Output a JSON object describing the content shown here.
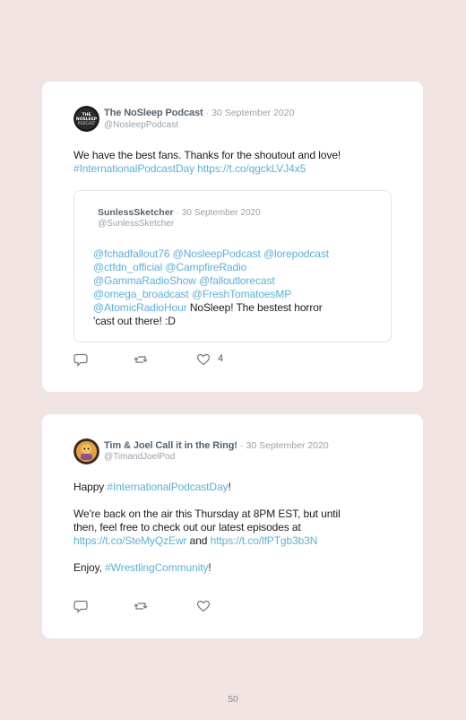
{
  "tweets": [
    {
      "author_name": "The NoSleep Podcast",
      "separator": "·",
      "date": "30 September 2020",
      "handle": "@NosleepPodcast",
      "avatar_text": "THE NOSLEEP PODCAST",
      "text_line1": "We have the best fans. Thanks for the shoutout and love!",
      "hashtag": "#InternationalPodcastDay",
      "link": "https://t.co/qgckLVJ4x5",
      "quote": {
        "author_name": "SunlessSketcher",
        "separator": "·",
        "date": "30 September 2020",
        "handle": "@SunlessSketcher",
        "mention_line1": "@fchadfallout76 @NosleepPodcast @lorepodcast",
        "mention_line2": "@ctfdn_official @CampfireRadio",
        "mention_line3": "@GammaRadioShow @falloutlorecast",
        "mention_line4": "@omega_broadcast @FreshTomatoesMP",
        "mention_line5": "@AtomicRadioHour",
        "text_tail": " NoSleep! The bestest horror",
        "text_line6": "'cast out there! :D"
      },
      "like_count": "4"
    },
    {
      "author_name": "Tim & Joel Call it in the Ring!",
      "separator": "·",
      "date": "30 September 2020",
      "handle": "@TimandJoelPod",
      "p1_prefix": "Happy ",
      "p1_hashtag": "#InternationalPodcastDay",
      "p1_suffix": "!",
      "p2_line1": "We're back on the air this Thursday at 8PM EST, but until",
      "p2_line2": "then, feel free to check out our latest episodes at",
      "p2_link1": "https://t.co/SteMyQzEwr",
      "p2_and": " and ",
      "p2_link2": "https://t.co/lfPTgb3b3N",
      "p3_prefix": "Enjoy, ",
      "p3_hashtag": "#WrestlingCommunity",
      "p3_suffix": "!"
    }
  ],
  "icons": {
    "reply": "reply-icon",
    "retweet": "retweet-icon",
    "like": "heart-icon"
  },
  "colors": {
    "background": "#f2e3e3",
    "card": "#ffffff",
    "link": "#5cb0dd",
    "author": "#54636f",
    "muted": "#9aa2a9"
  },
  "page_number": "50"
}
